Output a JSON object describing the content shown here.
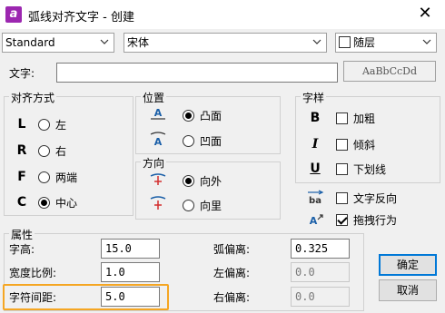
{
  "window": {
    "title": "弧线对齐文字 - 创建",
    "close_glyph": "✕"
  },
  "top": {
    "style_value": "Standard",
    "font_value": "宋体",
    "layer_label": "随层"
  },
  "text_row": {
    "label": "文字:",
    "value": "",
    "preview": "AaBbCcDd"
  },
  "align": {
    "title": "对齐方式",
    "items": [
      {
        "glyph": "L",
        "label": "左",
        "selected": false
      },
      {
        "glyph": "R",
        "label": "右",
        "selected": false
      },
      {
        "glyph": "F",
        "label": "两端",
        "selected": false
      },
      {
        "glyph": "C",
        "label": "中心",
        "selected": true
      }
    ]
  },
  "position": {
    "title": "位置",
    "items": [
      {
        "label": "凸面",
        "selected": true
      },
      {
        "label": "凹面",
        "selected": false
      }
    ]
  },
  "direction": {
    "title": "方向",
    "items": [
      {
        "label": "向外",
        "selected": true
      },
      {
        "label": "向里",
        "selected": false
      }
    ]
  },
  "style": {
    "title": "字样",
    "items": [
      {
        "glyph": "B",
        "label": "加粗",
        "checked": false
      },
      {
        "glyph": "I",
        "label": "倾斜",
        "checked": false
      },
      {
        "glyph": "U",
        "label": "下划线",
        "checked": false
      }
    ],
    "reverse_label": "文字反向",
    "reverse_checked": false,
    "drag_label": "拖拽行为",
    "drag_checked": true
  },
  "props": {
    "title": "属性",
    "height_label": "字高:",
    "height_value": "15.0",
    "width_label": "宽度比例:",
    "width_value": "1.0",
    "spacing_label": "字符间距:",
    "spacing_value": "5.0",
    "arc_offset_label": "弧偏离:",
    "arc_offset_value": "0.325",
    "left_offset_label": "左偏离:",
    "left_offset_value": "0.0",
    "right_offset_label": "右偏离:",
    "right_offset_value": "0.0"
  },
  "buttons": {
    "ok": "确定",
    "cancel": "取消"
  },
  "colors": {
    "accent": "#0078d7",
    "highlight": "#f5a623",
    "app_icon": "#9c27b0"
  }
}
